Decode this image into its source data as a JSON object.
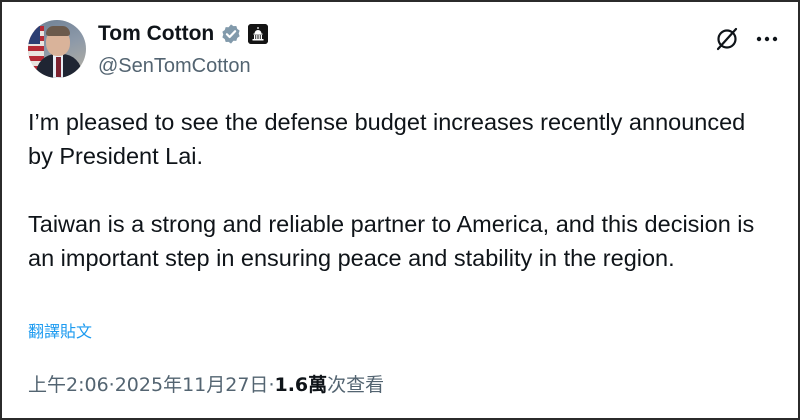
{
  "author": {
    "name": "Tom Cotton",
    "handle": "@SenTomCotton"
  },
  "icons": {
    "verified": "verified-badge-icon",
    "government": "capitol-building-icon",
    "grok": "grok-icon",
    "more": "more-horizontal-icon"
  },
  "colors": {
    "verified_badge": "#829aab",
    "link": "#1d9bf0",
    "secondary_text": "#536471",
    "primary_text": "#0f1419"
  },
  "tweet": {
    "paragraph1": "I’m pleased to see the defense budget increases recently announced by President Lai.",
    "paragraph2": "Taiwan is a strong and reliable partner to America, and this decision is an important step in ensuring peace and stability in the region.",
    "translate_label": "翻譯貼文"
  },
  "meta": {
    "time": "上午2:06",
    "separator1": " · ",
    "date": "2025年11月27日",
    "separator2": " · ",
    "views_count": "1.6萬",
    "views_label": " 次查看"
  }
}
